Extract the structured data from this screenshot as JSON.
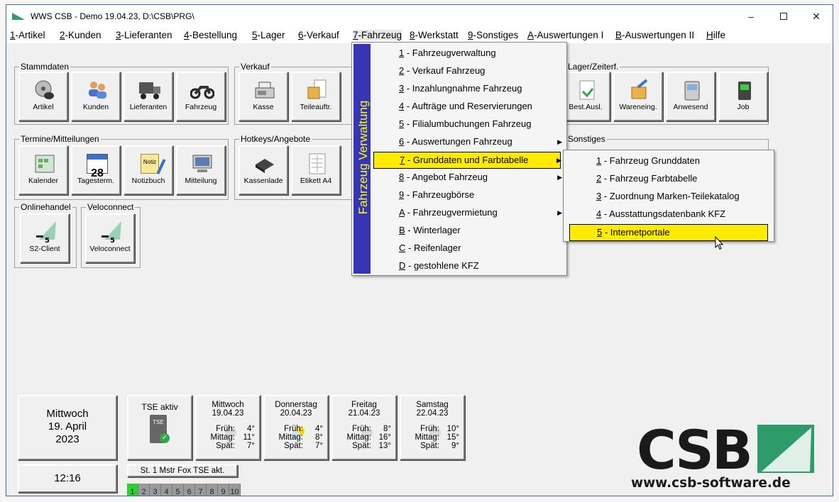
{
  "window": {
    "title": "WWS CSB - Demo  19.04.23, D:\\CSB\\PRG\\"
  },
  "menubar": [
    {
      "key": "1",
      "rest": "-Artikel"
    },
    {
      "key": "2",
      "rest": "-Kunden"
    },
    {
      "key": "3",
      "rest": "-Lieferanten"
    },
    {
      "key": "4",
      "rest": "-Bestellung"
    },
    {
      "key": "5",
      "rest": "-Lager"
    },
    {
      "key": "6",
      "rest": "-Verkauf"
    },
    {
      "key": "7",
      "rest": "-Fahrzeug"
    },
    {
      "key": "8",
      "rest": "-Werkstatt"
    },
    {
      "key": "9",
      "rest": "-Sonstiges"
    },
    {
      "key": "A",
      "rest": "-Auswertungen I"
    },
    {
      "key": "B",
      "rest": "-Auswertungen II"
    },
    {
      "key": "H",
      "rest": "ilfe"
    }
  ],
  "groups": {
    "stammdaten": {
      "label": "Stammdaten",
      "tiles": [
        "Artikel",
        "Kunden",
        "Lieferanten",
        "Fahrzeug"
      ]
    },
    "verkauf": {
      "label": "Verkauf",
      "tiles": [
        "Kasse",
        "Teileauftr."
      ]
    },
    "lager": {
      "label": "Lager/Zeiterf.",
      "tiles": [
        "Best.Ausl.",
        "Wareneing.",
        "Anwesend",
        "Job"
      ]
    },
    "termine": {
      "label": "Termine/Mitteilungen",
      "tiles": [
        "Kalender",
        "Tagesterm.",
        "Notizbuch",
        "Mitteilung"
      ]
    },
    "hotkeys": {
      "label": "Hotkeys/Angebote",
      "tiles": [
        "Kassenlade",
        "Etikett A4"
      ]
    },
    "sonstiges": {
      "label": "Sonstiges"
    },
    "onlinehandel": {
      "label": "Onlinehandel",
      "tiles": [
        "S2-Client"
      ]
    },
    "veloconnect": {
      "label": "Veloconnect",
      "tiles": [
        "Veloconnect"
      ]
    }
  },
  "icons": {
    "calendar_day": "28",
    "notepad_text": "Notiz"
  },
  "dropdown": {
    "band": "Fahrzeug Verwaltung",
    "items": [
      {
        "key": "1",
        "text": " - Fahrzeugverwaltung"
      },
      {
        "key": "2",
        "text": " - Verkauf Fahrzeug"
      },
      {
        "key": "3",
        "text": " - Inzahlungnahme Fahrzeug"
      },
      {
        "key": "4",
        "text": " - Aufträge und Reservierungen"
      },
      {
        "key": "5",
        "text": " - Filialumbuchungen Fahrzeug"
      },
      {
        "key": "6",
        "text": " - Auswertungen Fahrzeug"
      },
      {
        "key": "7",
        "text": " - Grunddaten und Farbtabelle"
      },
      {
        "key": "8",
        "text": " - Angebot Fahrzeug"
      },
      {
        "key": "9",
        "text": " - Fahrzeugbörse"
      },
      {
        "key": "A",
        "text": " - Fahrzeugvermietung"
      },
      {
        "key": "B",
        "text": " - Winterlager"
      },
      {
        "key": "C",
        "text": " - Reifenlager"
      },
      {
        "key": "D",
        "text": " - gestohlene KFZ"
      }
    ]
  },
  "submenu": {
    "items": [
      {
        "key": "1",
        "text": " - Fahrzeug Grunddaten"
      },
      {
        "key": "2",
        "text": " - Fahrzeug Farbtabelle"
      },
      {
        "key": "3",
        "text": " - Zuordnung Marken-Teilekatalog"
      },
      {
        "key": "4",
        "text": " - Ausstattungsdatenbank KFZ"
      },
      {
        "key": "5",
        "text": " - Internetportale"
      }
    ]
  },
  "date_panel": {
    "weekday": "Mittwoch",
    "date": "19. April",
    "year": "2023",
    "time": "12:16"
  },
  "tse": {
    "title": "TSE aktiv",
    "chip": "TSE",
    "status": "St. 1 Mstr Fox TSE akt."
  },
  "weather_labels": {
    "frueh": "Früh:",
    "mittag": "Mittag:",
    "spaet": "Spät:"
  },
  "weather": [
    {
      "day": "Mittwoch",
      "date": "19.04.23",
      "frueh": "4°",
      "mittag": "11°",
      "spaet": "7°"
    },
    {
      "day": "Donnerstag",
      "date": "20.04.23",
      "frueh": "4°",
      "mittag": "8°",
      "spaet": "7°"
    },
    {
      "day": "Freitag",
      "date": "21.04.23",
      "frueh": "8°",
      "mittag": "16°",
      "spaet": "13°"
    },
    {
      "day": "Samstag",
      "date": "22.04.23",
      "frueh": "10°",
      "mittag": "15°",
      "spaet": "9°"
    }
  ],
  "stations": {
    "labels": [
      "1",
      "2",
      "3",
      "4",
      "5",
      "6",
      "7",
      "8",
      "9",
      "10"
    ],
    "active": "1"
  },
  "brand": {
    "logo": "CSB",
    "url": "www.csb-software.de"
  }
}
